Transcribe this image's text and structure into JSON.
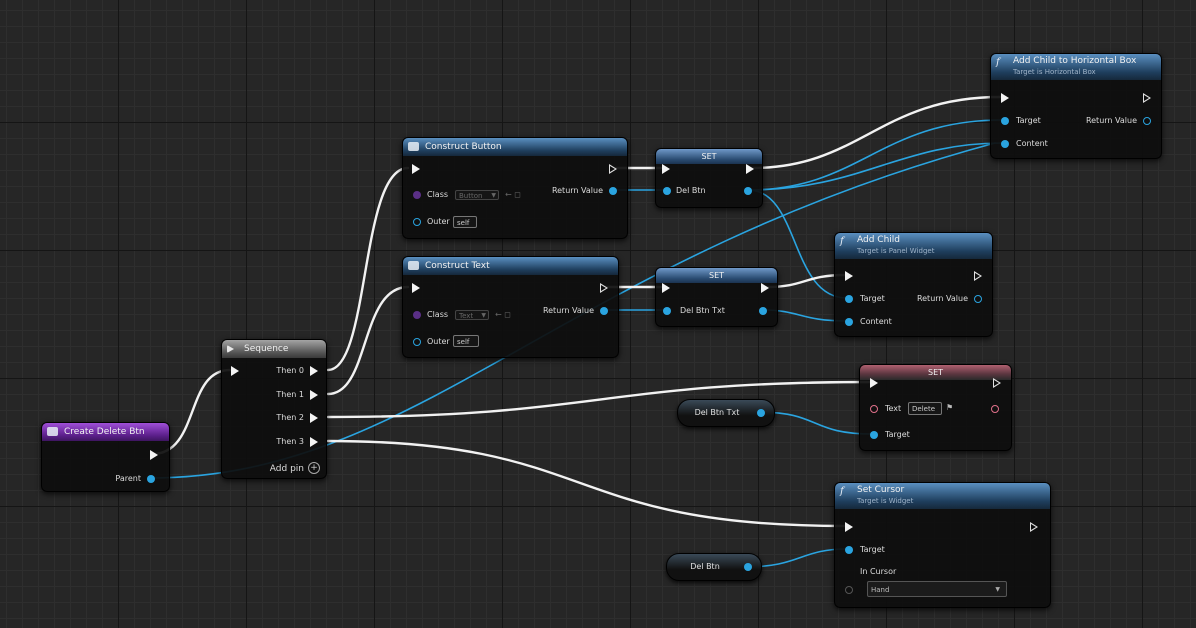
{
  "nodes": {
    "create_delete_btn": {
      "title": "Create Delete Btn",
      "pin_parent": "Parent"
    },
    "sequence": {
      "title": "Sequence",
      "then0": "Then 0",
      "then1": "Then 1",
      "then2": "Then 2",
      "then3": "Then 3",
      "add_pin": "Add pin"
    },
    "construct_button": {
      "title": "Construct Button",
      "class_label": "Class",
      "class_value": "Button",
      "outer_label": "Outer",
      "outer_value": "self",
      "return_label": "Return Value"
    },
    "construct_text": {
      "title": "Construct Text",
      "class_label": "Class",
      "class_value": "Text",
      "outer_label": "Outer",
      "outer_value": "self",
      "return_label": "Return Value"
    },
    "set_del_btn": {
      "title": "SET",
      "pin_label": "Del Btn"
    },
    "set_del_btn_txt": {
      "title": "SET",
      "pin_label": "Del Btn Txt"
    },
    "add_child_hbox": {
      "title": "Add Child to Horizontal Box",
      "subtitle": "Target is Horizontal Box",
      "target": "Target",
      "content": "Content",
      "return_label": "Return Value"
    },
    "add_child": {
      "title": "Add Child",
      "subtitle": "Target is Panel Widget",
      "target": "Target",
      "content": "Content",
      "return_label": "Return Value"
    },
    "set_text": {
      "title": "SET",
      "text_label": "Text",
      "text_value": "Delete",
      "target": "Target"
    },
    "set_cursor": {
      "title": "Set Cursor",
      "subtitle": "Target is Widget",
      "target": "Target",
      "in_cursor": "In Cursor",
      "cursor_value": "Hand"
    },
    "get_del_btn_txt": {
      "label": "Del Btn Txt"
    },
    "get_del_btn": {
      "label": "Del Btn"
    }
  },
  "colors": {
    "exec_wire": "#f2f2f2",
    "object_wire": "#2aa4e0",
    "text_pin": "#e0708a",
    "struct_pin": "#5a2f86"
  }
}
